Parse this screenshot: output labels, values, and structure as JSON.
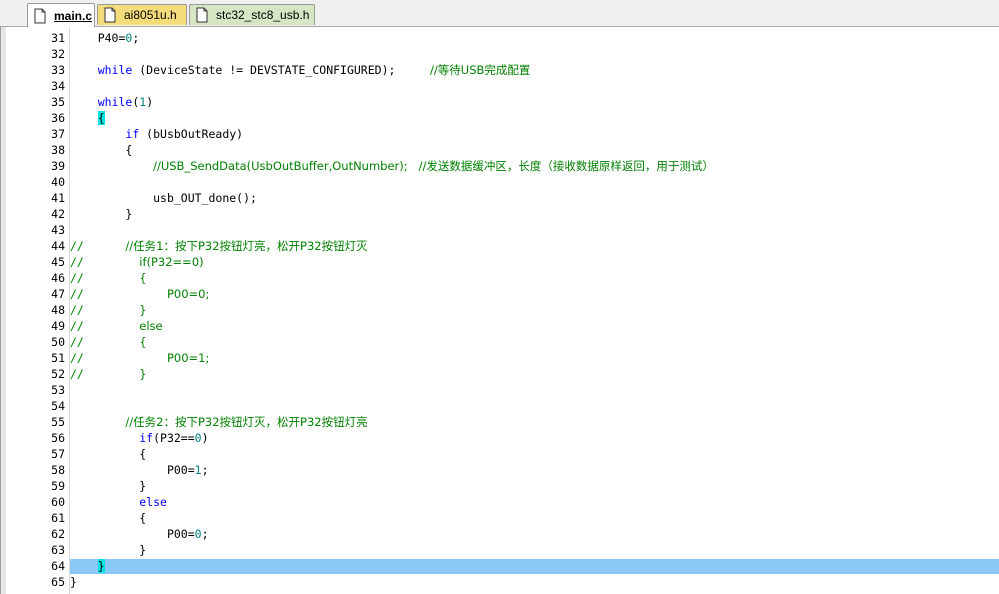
{
  "tabs": [
    {
      "label": "main.c",
      "active": true
    },
    {
      "label": "ai8051u.h",
      "active": false
    },
    {
      "label": "stc32_stc8_usb.h",
      "active": false
    }
  ],
  "colors": {
    "keyword": "#0000ff",
    "comment": "#008000",
    "number": "#008080",
    "current_line": "#8cc8f5",
    "brace_match": "#00e5e5",
    "tab_header_yellow": "#f5dc7a",
    "tab_header_green": "#d6e6c4"
  },
  "lines": [
    {
      "n": "31",
      "gutter": "",
      "indent": "    ",
      "tokens": [
        {
          "t": "P40=",
          "c": "plain"
        },
        {
          "t": "0",
          "c": "num"
        },
        {
          "t": ";",
          "c": "plain"
        }
      ]
    },
    {
      "n": "32",
      "gutter": "",
      "indent": "",
      "tokens": []
    },
    {
      "n": "33",
      "gutter": "",
      "indent": "    ",
      "tokens": [
        {
          "t": "while",
          "c": "kw"
        },
        {
          "t": " (DeviceState != DEVSTATE_CONFIGURED);     ",
          "c": "plain"
        },
        {
          "t": "//等待USB完成配置",
          "c": "cmt"
        }
      ]
    },
    {
      "n": "34",
      "gutter": "",
      "indent": "",
      "tokens": []
    },
    {
      "n": "35",
      "gutter": "",
      "indent": "    ",
      "tokens": [
        {
          "t": "while",
          "c": "kw"
        },
        {
          "t": "(",
          "c": "plain"
        },
        {
          "t": "1",
          "c": "num"
        },
        {
          "t": ")",
          "c": "plain"
        }
      ]
    },
    {
      "n": "36",
      "gutter": "",
      "indent": "    ",
      "tokens": [
        {
          "t": "{",
          "c": "bracehl"
        }
      ]
    },
    {
      "n": "37",
      "gutter": "",
      "indent": "        ",
      "tokens": [
        {
          "t": "if",
          "c": "kw"
        },
        {
          "t": " (bUsbOutReady)",
          "c": "plain"
        }
      ]
    },
    {
      "n": "38",
      "gutter": "",
      "indent": "        ",
      "tokens": [
        {
          "t": "{",
          "c": "plain"
        }
      ]
    },
    {
      "n": "39",
      "gutter": "",
      "indent": "            ",
      "tokens": [
        {
          "t": "//USB_SendData(UsbOutBuffer,OutNumber);   //发送数据缓冲区，长度（接收数据原样返回，用于测试）",
          "c": "cmt"
        }
      ]
    },
    {
      "n": "40",
      "gutter": "",
      "indent": "",
      "tokens": []
    },
    {
      "n": "41",
      "gutter": "",
      "indent": "            ",
      "tokens": [
        {
          "t": "usb_OUT_done();",
          "c": "plain"
        }
      ]
    },
    {
      "n": "42",
      "gutter": "",
      "indent": "        ",
      "tokens": [
        {
          "t": "}",
          "c": "plain"
        }
      ]
    },
    {
      "n": "43",
      "gutter": "",
      "indent": "",
      "tokens": []
    },
    {
      "n": "44",
      "gutter": "//",
      "indent": "        ",
      "tokens": [
        {
          "t": "//任务1：按下P32按钮灯亮，松开P32按钮灯灭",
          "c": "cmt"
        }
      ]
    },
    {
      "n": "45",
      "gutter": "//",
      "indent": "          ",
      "tokens": [
        {
          "t": "if(P32==0)",
          "c": "cmt"
        }
      ]
    },
    {
      "n": "46",
      "gutter": "//",
      "indent": "          ",
      "tokens": [
        {
          "t": "{",
          "c": "cmt"
        }
      ]
    },
    {
      "n": "47",
      "gutter": "//",
      "indent": "              ",
      "tokens": [
        {
          "t": "P00=0;",
          "c": "cmt"
        }
      ]
    },
    {
      "n": "48",
      "gutter": "//",
      "indent": "          ",
      "tokens": [
        {
          "t": "}",
          "c": "cmt"
        }
      ]
    },
    {
      "n": "49",
      "gutter": "//",
      "indent": "          ",
      "tokens": [
        {
          "t": "else",
          "c": "cmt"
        }
      ]
    },
    {
      "n": "50",
      "gutter": "//",
      "indent": "          ",
      "tokens": [
        {
          "t": "{",
          "c": "cmt"
        }
      ]
    },
    {
      "n": "51",
      "gutter": "//",
      "indent": "              ",
      "tokens": [
        {
          "t": "P00=1;",
          "c": "cmt"
        }
      ]
    },
    {
      "n": "52",
      "gutter": "//",
      "indent": "          ",
      "tokens": [
        {
          "t": "}",
          "c": "cmt"
        }
      ]
    },
    {
      "n": "53",
      "gutter": "",
      "indent": "",
      "tokens": []
    },
    {
      "n": "54",
      "gutter": "",
      "indent": "",
      "tokens": []
    },
    {
      "n": "55",
      "gutter": "",
      "indent": "        ",
      "tokens": [
        {
          "t": "//任务2：按下P32按钮灯灭，松开P32按钮灯亮",
          "c": "cmt"
        }
      ]
    },
    {
      "n": "56",
      "gutter": "",
      "indent": "          ",
      "tokens": [
        {
          "t": "if",
          "c": "kw"
        },
        {
          "t": "(P32==",
          "c": "plain"
        },
        {
          "t": "0",
          "c": "num"
        },
        {
          "t": ")",
          "c": "plain"
        }
      ]
    },
    {
      "n": "57",
      "gutter": "",
      "indent": "          ",
      "tokens": [
        {
          "t": "{",
          "c": "plain"
        }
      ]
    },
    {
      "n": "58",
      "gutter": "",
      "indent": "              ",
      "tokens": [
        {
          "t": "P00=",
          "c": "plain"
        },
        {
          "t": "1",
          "c": "num"
        },
        {
          "t": ";",
          "c": "plain"
        }
      ]
    },
    {
      "n": "59",
      "gutter": "",
      "indent": "          ",
      "tokens": [
        {
          "t": "}",
          "c": "plain"
        }
      ]
    },
    {
      "n": "60",
      "gutter": "",
      "indent": "          ",
      "tokens": [
        {
          "t": "else",
          "c": "kw"
        }
      ]
    },
    {
      "n": "61",
      "gutter": "",
      "indent": "          ",
      "tokens": [
        {
          "t": "{",
          "c": "plain"
        }
      ]
    },
    {
      "n": "62",
      "gutter": "",
      "indent": "              ",
      "tokens": [
        {
          "t": "P00=",
          "c": "plain"
        },
        {
          "t": "0",
          "c": "num"
        },
        {
          "t": ";",
          "c": "plain"
        }
      ]
    },
    {
      "n": "63",
      "gutter": "",
      "indent": "          ",
      "tokens": [
        {
          "t": "}",
          "c": "plain"
        }
      ]
    },
    {
      "n": "64",
      "gutter": "",
      "indent": "    ",
      "highlight": true,
      "tokens": [
        {
          "t": "}",
          "c": "bracehl"
        }
      ]
    },
    {
      "n": "65",
      "gutter": "",
      "indent": "",
      "tokens": [
        {
          "t": "}",
          "c": "plain"
        }
      ]
    }
  ]
}
